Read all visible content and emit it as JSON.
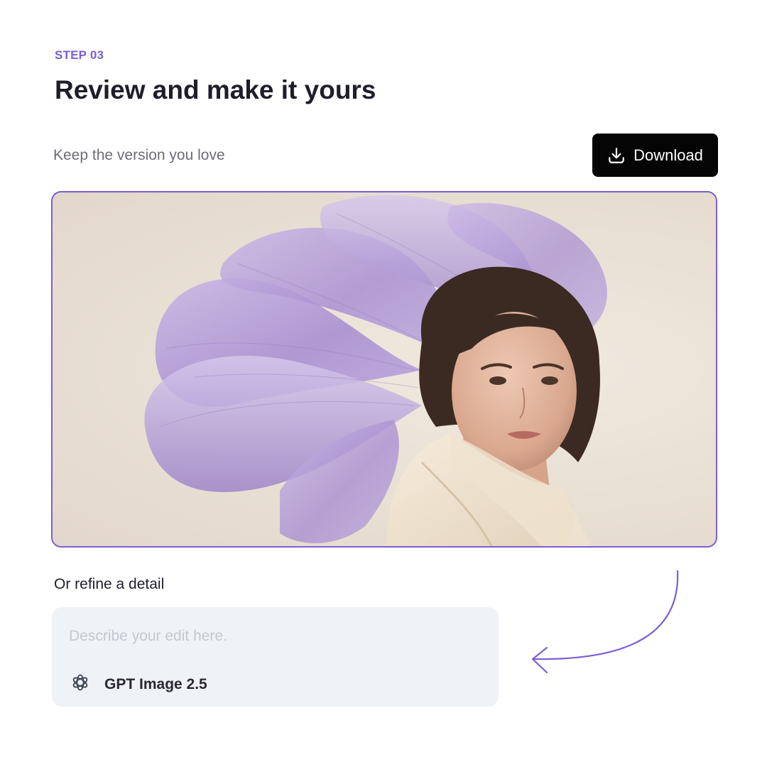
{
  "header": {
    "step_label": "STEP 03",
    "title": "Review and make it yours"
  },
  "result": {
    "subtitle": "Keep the version you love",
    "download_label": "Download",
    "download_icon": "download-icon"
  },
  "refine": {
    "label": "Or refine a detail",
    "placeholder": "Describe your edit here.",
    "value": "",
    "model_icon": "openai-logo-icon",
    "model_name": "GPT Image 2.5"
  },
  "colors": {
    "accent": "#7b5ed8",
    "button_bg": "#050505",
    "prompt_bg": "#eff2f6"
  }
}
